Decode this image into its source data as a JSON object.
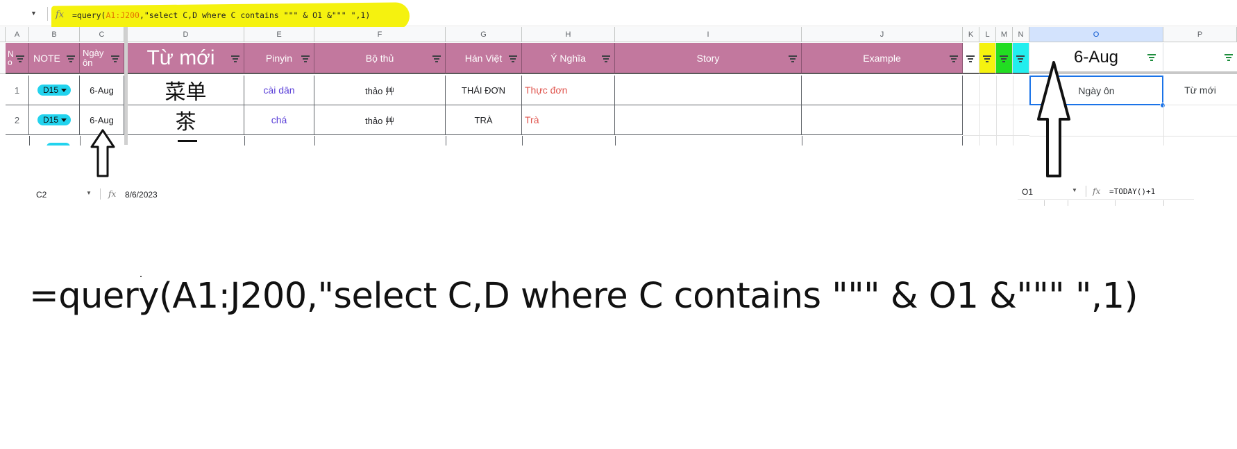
{
  "formula_bar": {
    "fx": "fx",
    "formula_prefix": "=query(",
    "formula_range": "A1:J200",
    "formula_rest": ",\"select C,D where C contains \"\"\" & O1 &\"\"\" \",1)"
  },
  "columns": [
    "A",
    "B",
    "C",
    "D",
    "E",
    "F",
    "G",
    "H",
    "I",
    "J",
    "K",
    "L",
    "M",
    "N",
    "O",
    "P"
  ],
  "header_row": {
    "A": "N o",
    "B": "NOTE",
    "C": "Ngày ôn",
    "D": "Từ mới",
    "E": "Pinyin",
    "F": "Bộ thủ",
    "G": "Hán Việt",
    "H": "Ý Nghĩa",
    "I": "Story",
    "J": "Example",
    "O": "6-Aug"
  },
  "rows": [
    {
      "no": "1",
      "note": "D15",
      "date": "6-Aug",
      "word": "菜单",
      "pinyin": "cài dān",
      "radical": "thảo 艸",
      "han_viet": "THÁI ĐƠN",
      "meaning": "Thực đơn",
      "story": "",
      "example": ""
    },
    {
      "no": "2",
      "note": "D15",
      "date": "6-Aug",
      "word": "茶",
      "pinyin": "chá",
      "radical": "thảo 艸",
      "han_viet": "TRÀ",
      "meaning": "Trà",
      "story": "",
      "example": ""
    }
  ],
  "query_result_header": {
    "o": "Ngày ôn",
    "p": "Từ mới"
  },
  "formula_bar_c2": {
    "cell": "C2",
    "fx": "fx",
    "value": "8/6/2023"
  },
  "formula_bar_o1": {
    "cell": "O1",
    "fx": "fx",
    "value": "=TODAY()+1"
  },
  "big_formula": "=query(A1:J200,\"select C,D where C contains \"\"\" & O1 &\"\"\" \",1)",
  "colors": {
    "header_bg": "#c2789e",
    "pill": "#22d3ee",
    "yellow": "#f5f20f",
    "green": "#22dd22",
    "cyan": "#22eeee",
    "pinyin": "#5b40d8",
    "meaning": "#e0554e"
  }
}
